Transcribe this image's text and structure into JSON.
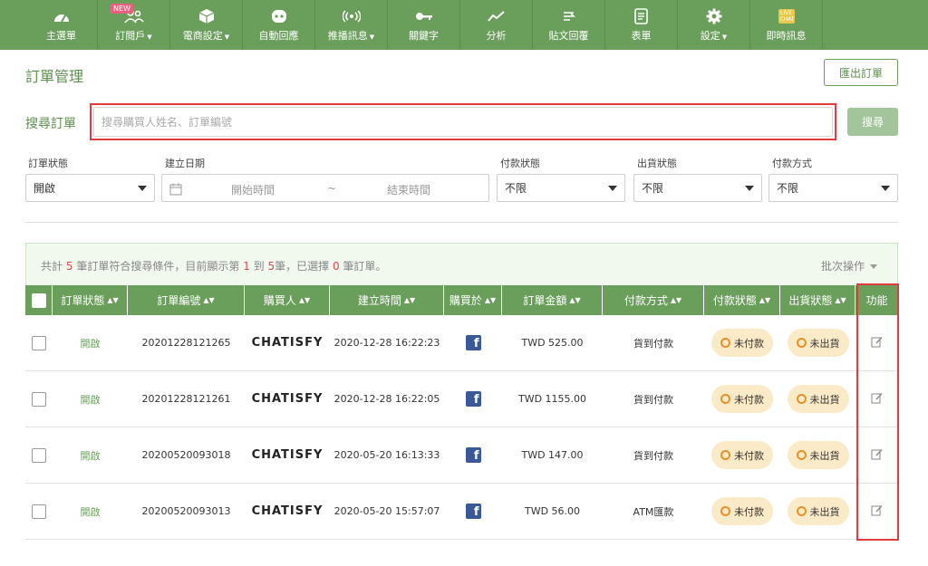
{
  "nav": [
    {
      "label": "主選單",
      "icon": "dashboard-icon",
      "caret": false,
      "badge": ""
    },
    {
      "label": "訂閱戶",
      "icon": "users-icon",
      "caret": true,
      "badge": "NEW"
    },
    {
      "label": "電商設定",
      "icon": "box-icon",
      "caret": true,
      "badge": ""
    },
    {
      "label": "自動回應",
      "icon": "bot-icon",
      "caret": false,
      "badge": ""
    },
    {
      "label": "推播訊息",
      "icon": "broadcast-icon",
      "caret": true,
      "badge": ""
    },
    {
      "label": "關鍵字",
      "icon": "key-icon",
      "caret": false,
      "badge": ""
    },
    {
      "label": "分析",
      "icon": "analytics-icon",
      "caret": false,
      "badge": ""
    },
    {
      "label": "貼文回覆",
      "icon": "reply-icon",
      "caret": false,
      "badge": ""
    },
    {
      "label": "表單",
      "icon": "form-icon",
      "caret": false,
      "badge": ""
    },
    {
      "label": "設定",
      "icon": "gear-icon",
      "caret": true,
      "badge": ""
    },
    {
      "label": "即時訊息",
      "icon": "live-chat-icon",
      "caret": false,
      "badge": "LIVE CHAT"
    }
  ],
  "page": {
    "title": "訂單管理",
    "export_label": "匯出訂單"
  },
  "search": {
    "label": "搜尋訂單",
    "placeholder": "搜尋購買人姓名、訂單編號",
    "button": "搜尋"
  },
  "filters": {
    "order_status": {
      "label": "訂單狀態",
      "value": "開啟"
    },
    "created_date": {
      "label": "建立日期",
      "start": "開始時間",
      "separator": "~",
      "end": "結束時間"
    },
    "payment_status": {
      "label": "付款狀態",
      "value": "不限"
    },
    "shipping_status": {
      "label": "出貨狀態",
      "value": "不限"
    },
    "payment_method": {
      "label": "付款方式",
      "value": "不限"
    }
  },
  "summary": {
    "p1": "共計",
    "total": "5",
    "p2": "筆訂單符合搜尋條件，目前顯示第",
    "from": "1",
    "p3": "到",
    "to": "5",
    "p4": "筆，已選擇",
    "selected": "0",
    "p5": "筆訂單。",
    "batch": "批次操作"
  },
  "columns": {
    "order_status": "訂單狀態",
    "order_no": "訂單編號",
    "buyer": "購買人",
    "created": "建立時間",
    "platform": "購買於",
    "amount": "訂單金額",
    "method": "付款方式",
    "payment": "付款狀態",
    "shipping": "出貨狀態",
    "actions": "功能"
  },
  "rows": [
    {
      "status": "開啟",
      "order_no": "20201228121265",
      "buyer": "CHATISFY",
      "created": "2020-12-28 16:22:23",
      "platform": "facebook-icon",
      "amount": "TWD 525.00",
      "method": "貨到付款",
      "payment": "未付款",
      "shipping": "未出貨"
    },
    {
      "status": "開啟",
      "order_no": "20201228121261",
      "buyer": "CHATISFY",
      "created": "2020-12-28 16:22:05",
      "platform": "facebook-icon",
      "amount": "TWD 1155.00",
      "method": "貨到付款",
      "payment": "未付款",
      "shipping": "未出貨"
    },
    {
      "status": "開啟",
      "order_no": "20200520093018",
      "buyer": "CHATISFY",
      "created": "2020-05-20 16:13:33",
      "platform": "facebook-icon",
      "amount": "TWD 147.00",
      "method": "貨到付款",
      "payment": "未付款",
      "shipping": "未出貨"
    },
    {
      "status": "開啟",
      "order_no": "20200520093013",
      "buyer": "CHATISFY",
      "created": "2020-05-20 15:57:07",
      "platform": "facebook-icon",
      "amount": "TWD 56.00",
      "method": "ATM匯款",
      "payment": "未付款",
      "shipping": "未出貨"
    }
  ],
  "colors": {
    "brand_green": "#6a9e5b",
    "highlight_red": "#e23b3b",
    "pill_bg": "#fbeac7",
    "pill_ring": "#e8912a",
    "facebook": "#3b5998"
  }
}
